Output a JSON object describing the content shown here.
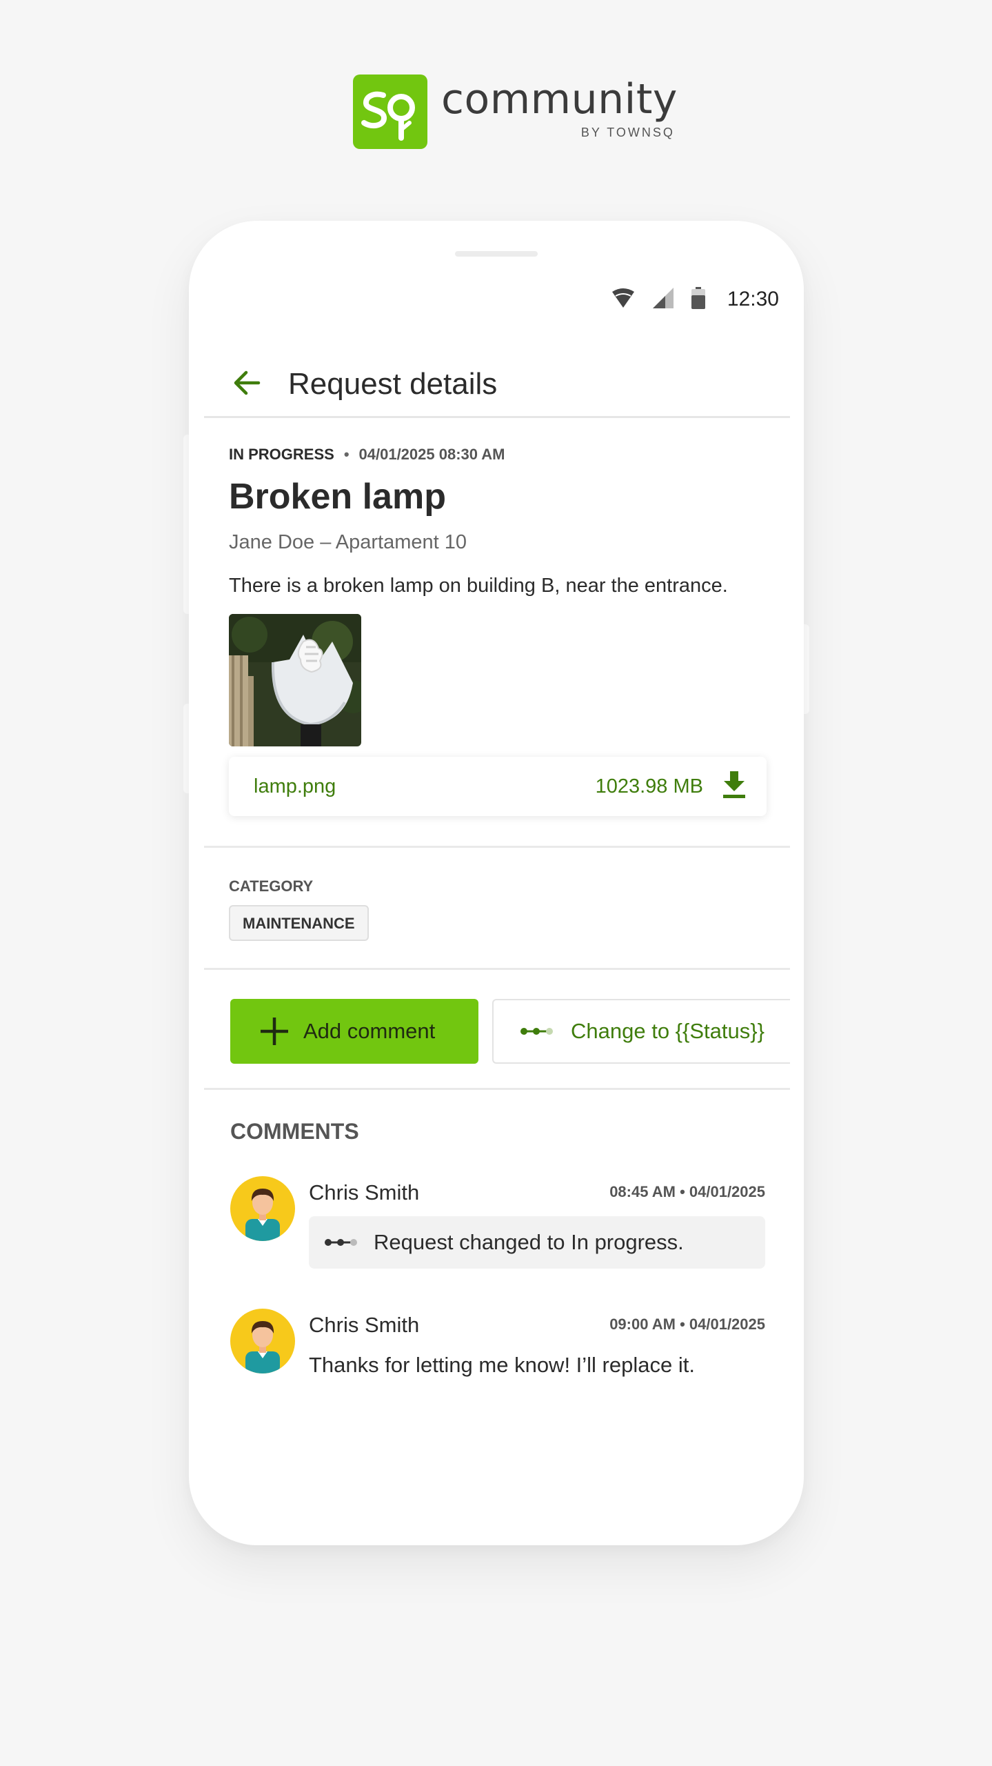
{
  "brand": {
    "logo_text": "Sq",
    "name": "community",
    "byline": "BY TOWNSQ",
    "color": "#72c610"
  },
  "status_bar": {
    "time": "12:30",
    "icons": [
      "wifi-icon",
      "cellular-signal-icon",
      "battery-icon"
    ]
  },
  "app_bar": {
    "back_icon": "arrow-left-icon",
    "title": "Request details"
  },
  "request": {
    "status": "IN PROGRESS",
    "separator": "•",
    "datetime": "04/01/2025 08:30 AM",
    "title": "Broken lamp",
    "author": "Jane Doe – Apartament 10",
    "description": "There is a broken lamp on building B, near the entrance.",
    "image_alt": "broken lamp photo"
  },
  "attachment": {
    "filename": "lamp.png",
    "size": "1023.98 MB",
    "icon": "download-icon"
  },
  "category": {
    "label": "CATEGORY",
    "value": "MAINTENANCE"
  },
  "actions": {
    "add_comment": "Add comment",
    "change_status": "Change to {{Status}}"
  },
  "comments": {
    "heading": "COMMENTS",
    "items": [
      {
        "author": "Chris Smith",
        "time": "08:45 AM • 04/01/2025",
        "type": "status_change",
        "text": "Request changed to In progress."
      },
      {
        "author": "Chris Smith",
        "time": "09:00 AM • 04/01/2025",
        "type": "message",
        "text": "Thanks for letting me know! I’ll replace it."
      }
    ]
  },
  "colors": {
    "accent_green": "#72c610",
    "link_green": "#3f7d0c",
    "avatar_yellow": "#f7c91b"
  }
}
